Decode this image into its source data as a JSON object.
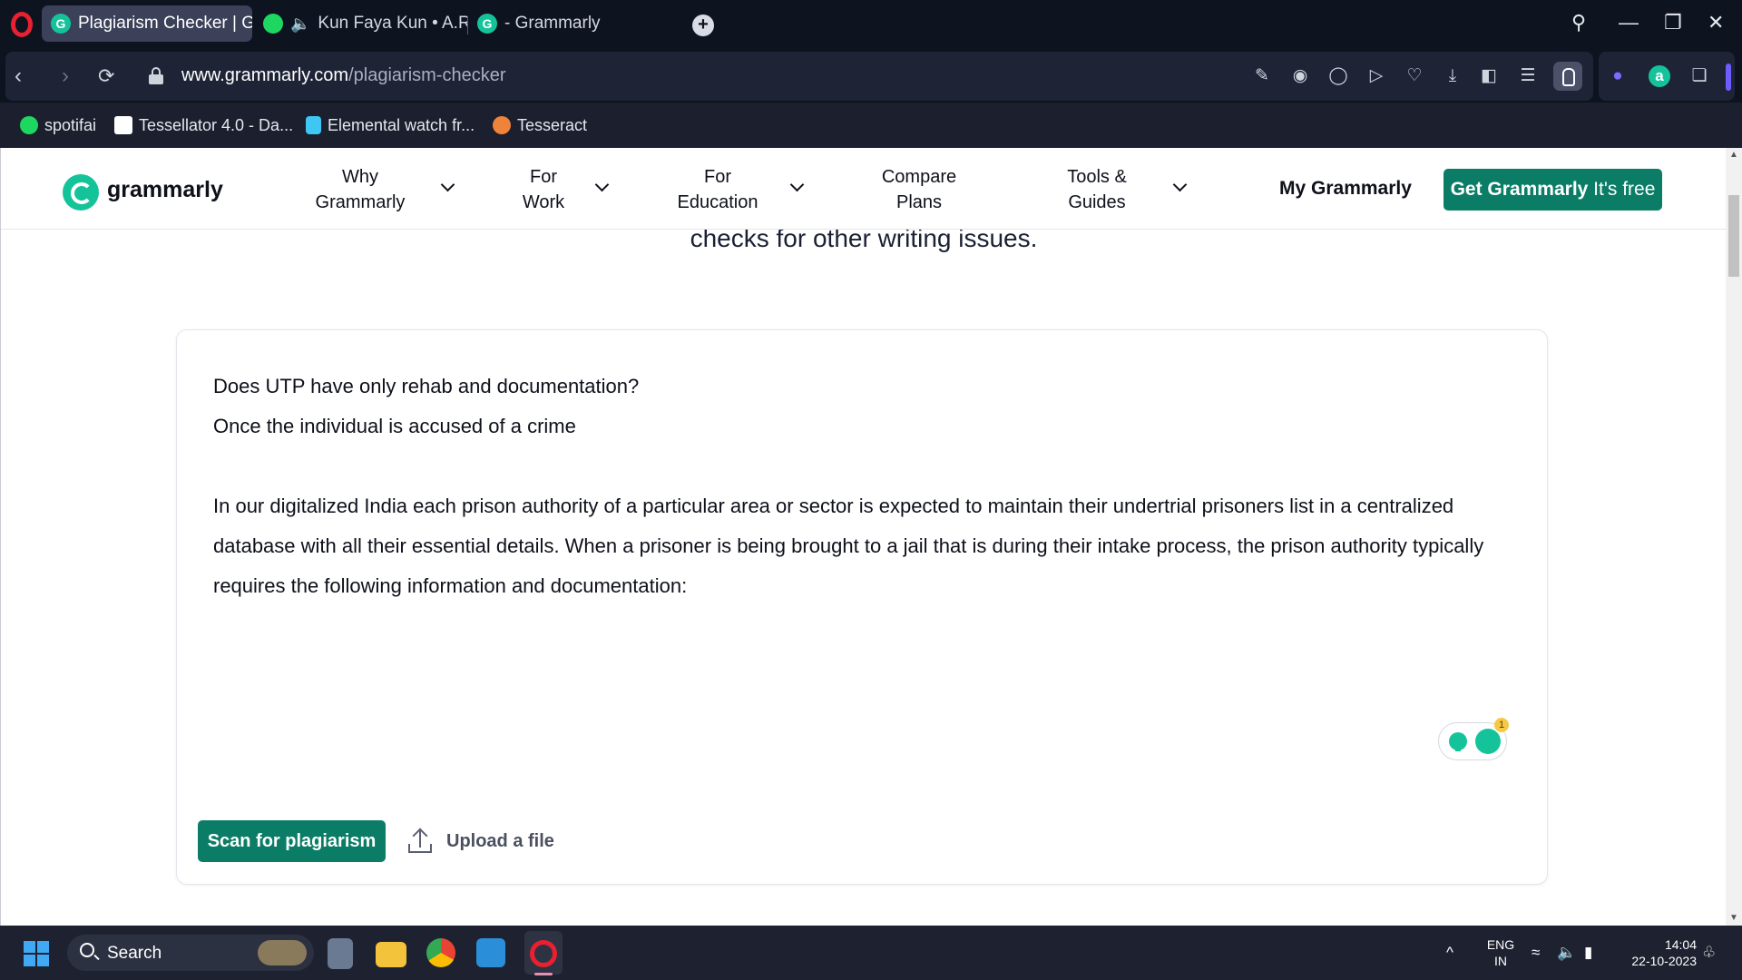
{
  "browser": {
    "tabs": [
      {
        "title": "Plagiarism Checker | Gra",
        "favicon": "G"
      },
      {
        "title": "Kun Faya Kun • A.R.",
        "favicon": "spotify"
      },
      {
        "title": "- Grammarly",
        "favicon": "G"
      }
    ],
    "new_tab_label": "+",
    "url_host": "www.grammarly.com",
    "url_path": "/plagiarism-checker",
    "bookmarks": [
      {
        "label": "spotifai",
        "icon": "spotify-icon",
        "color": "#1ed760"
      },
      {
        "label": "Tessellator 4.0 - Da...",
        "icon": "tessellator-icon",
        "color": "#ffffff"
      },
      {
        "label": "Elemental watch fr...",
        "icon": "elemental-icon",
        "color": "#3ec7f5"
      },
      {
        "label": "Tesseract",
        "icon": "tesseract-icon",
        "color": "#f0833a"
      }
    ],
    "toolbar_icons": [
      "edit-icon",
      "camera-icon",
      "shield-icon",
      "play-icon",
      "heart-icon",
      "download-icon",
      "layout-icon",
      "menu-icon"
    ]
  },
  "site": {
    "brand": "grammarly",
    "nav": [
      {
        "line1": "Why",
        "line2": "Grammarly"
      },
      {
        "line1": "For",
        "line2": "Work"
      },
      {
        "line1": "For",
        "line2": "Education"
      },
      {
        "line1": "Compare",
        "line2": "Plans"
      },
      {
        "line1": "Tools &",
        "line2": "Guides"
      }
    ],
    "my_grammarly": "My Grammarly",
    "cta_bold": "Get Grammarly",
    "cta_rest": " It's free",
    "intro_text": "checks for other writing issues.",
    "editor": {
      "line1": "Does UTP have only rehab and documentation?",
      "line2": "Once the individual is accused of a crime",
      "paragraph": "In our digitalized India each prison authority of a particular area or sector is expected to maintain their undertrial prisoners list in a centralized database with all their essential details. When a prisoner is being brought to a jail that is during their intake process, the prison authority typically requires the following information and documentation:",
      "badge_count": "1"
    },
    "scan_button": "Scan for plagiarism",
    "upload_label": "Upload a file",
    "accent": "#0b7d66",
    "brand_color": "#15c39a"
  },
  "taskbar": {
    "search_label": "Search",
    "lang_top": "ENG",
    "lang_bottom": "IN",
    "time": "14:04",
    "date": "22-10-2023",
    "overflow_icon": "^"
  }
}
